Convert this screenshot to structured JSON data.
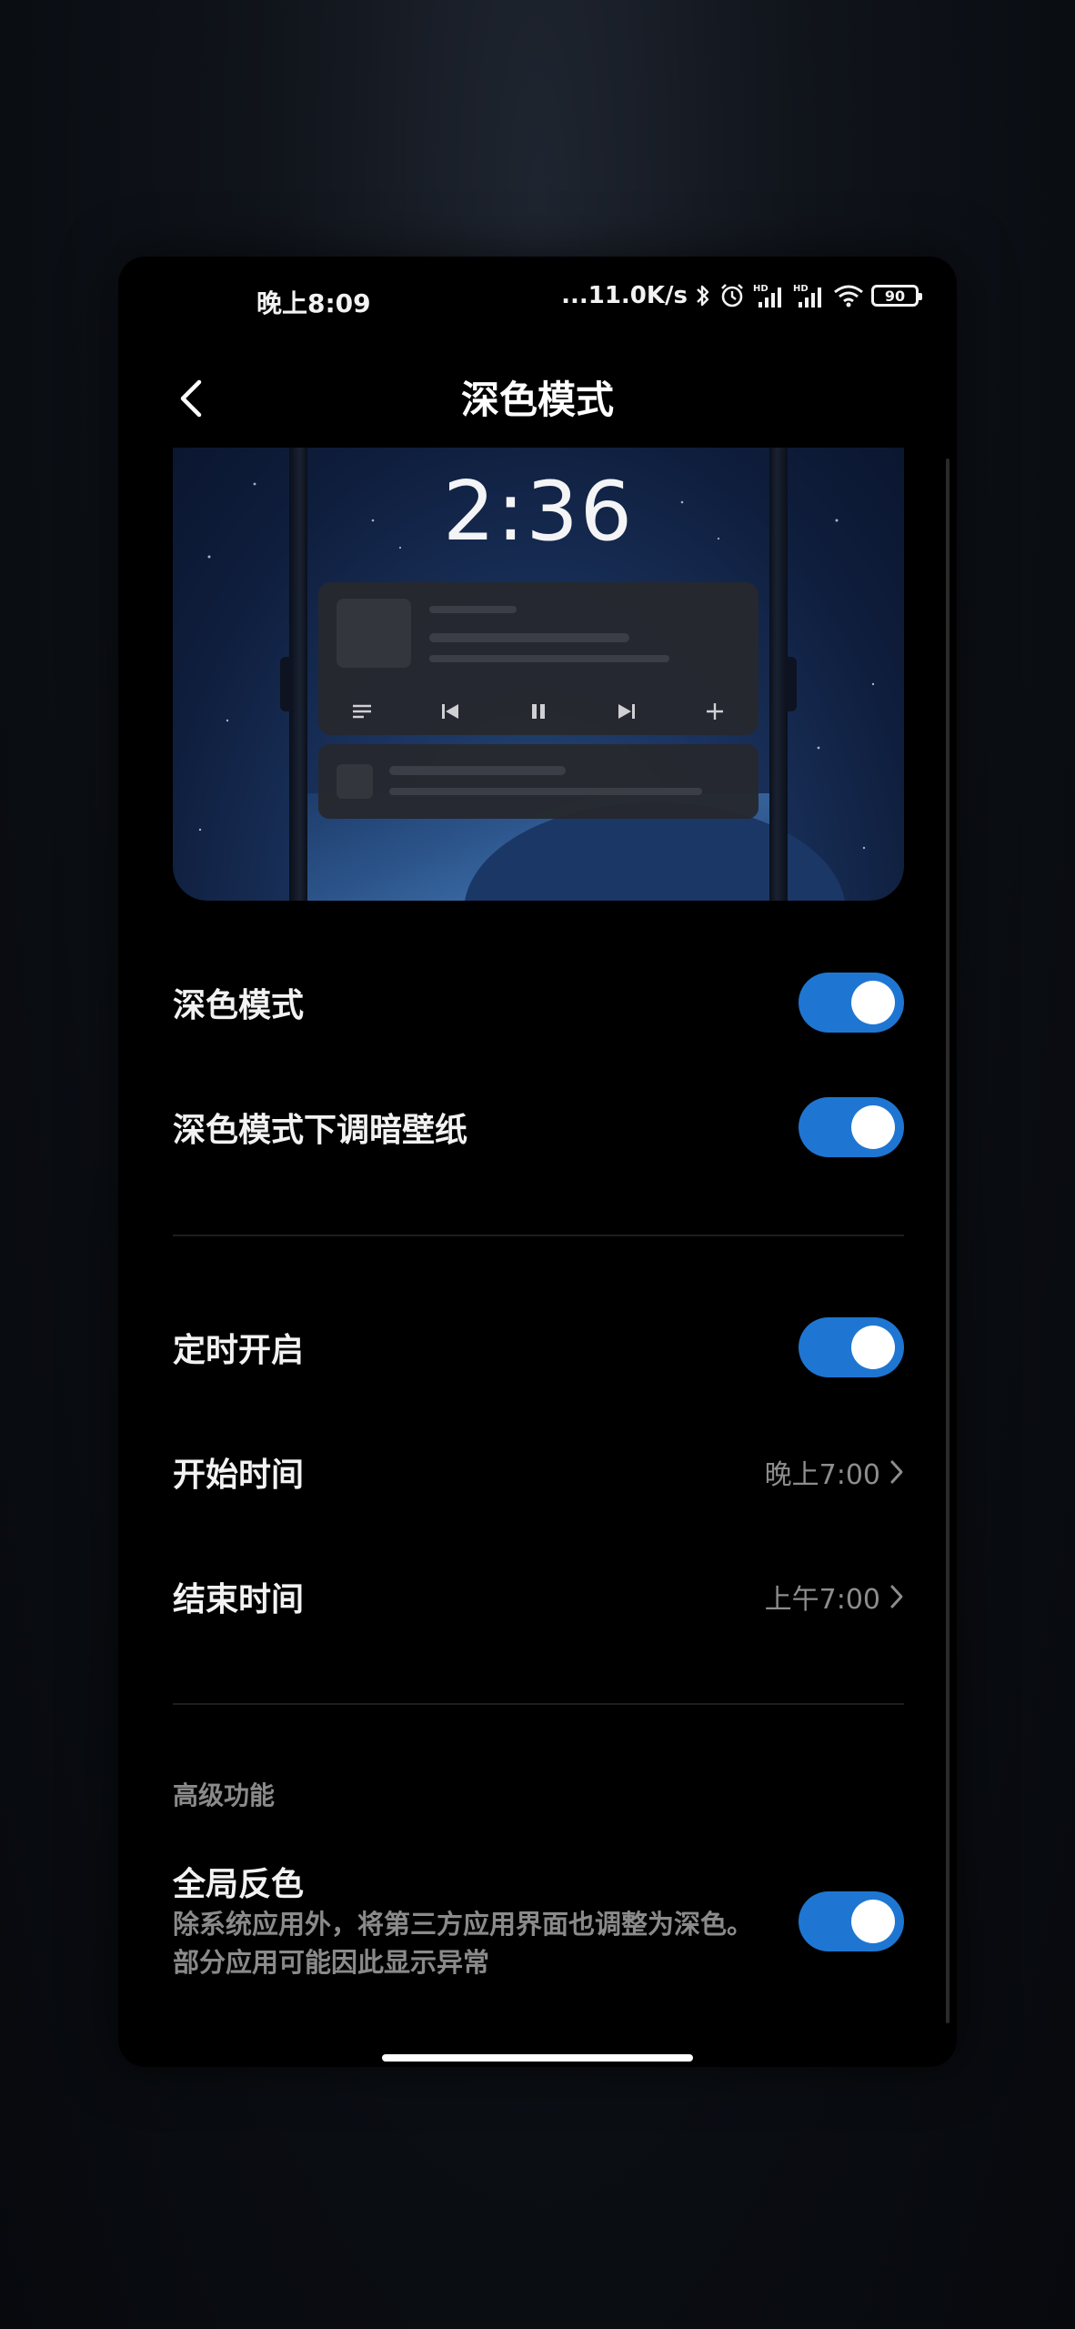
{
  "status_bar": {
    "time": "晚上8:09",
    "network_speed": "...11.0K/s",
    "battery": "90",
    "icons": [
      "bluetooth-icon",
      "alarm-icon",
      "signal-hd-icon",
      "signal-hd-icon",
      "wifi-icon",
      "battery-icon"
    ]
  },
  "header": {
    "title": "深色模式",
    "back_icon": "chevron-left-icon"
  },
  "preview": {
    "lock_time": "2:36",
    "media_icons": [
      "playlist-icon",
      "previous-icon",
      "pause-icon",
      "next-icon",
      "plus-icon"
    ]
  },
  "settings": {
    "dark_mode": {
      "label": "深色模式",
      "enabled": true
    },
    "dim_wallpaper": {
      "label": "深色模式下调暗壁纸",
      "enabled": true
    },
    "scheduled": {
      "label": "定时开启",
      "enabled": true
    },
    "start_time": {
      "label": "开始时间",
      "value": "晚上7:00"
    },
    "end_time": {
      "label": "结束时间",
      "value": "上午7:00"
    }
  },
  "advanced": {
    "section_title": "高级功能",
    "global_invert": {
      "label": "全局反色",
      "description": "除系统应用外，将第三方应用界面也调整为深色。部分应用可能因此显示异常",
      "enabled": true
    }
  },
  "colors": {
    "toggle_on": "#1e76d2",
    "background": "#000000",
    "secondary_text": "#8a8a8a"
  }
}
